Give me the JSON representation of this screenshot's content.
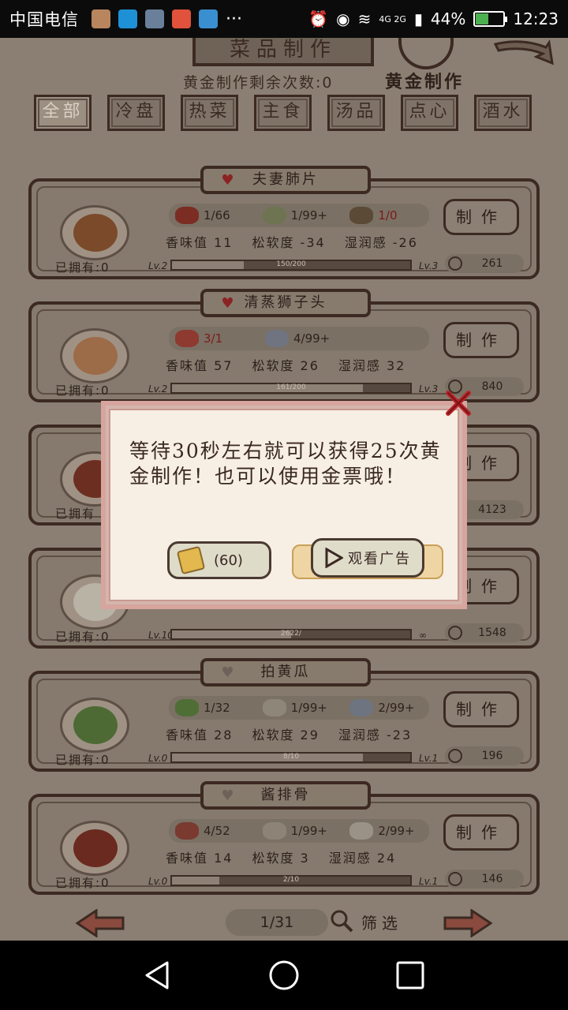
{
  "status_bar": {
    "carrier": "中国电信",
    "network": "4G 2G",
    "battery": "44%",
    "time": "12:23"
  },
  "header": {
    "title": "菜品制作",
    "gold_label": "黄金制作",
    "remaining": "黄金制作剩余次数:0"
  },
  "tabs": [
    {
      "label": "全部"
    },
    {
      "label": "冷盘"
    },
    {
      "label": "热菜"
    },
    {
      "label": "主食"
    },
    {
      "label": "汤品"
    },
    {
      "label": "点心"
    },
    {
      "label": "酒水"
    }
  ],
  "dishes": [
    {
      "name": "夫妻肺片",
      "ingredients": [
        {
          "count": "1/66"
        },
        {
          "count": "1/99+"
        },
        {
          "count": "1/0"
        }
      ],
      "aroma": "香味值 11",
      "softness": "松软度 -34",
      "moisture": "湿润感 -26",
      "owned": "已拥有:0",
      "level_left": "Lv.2",
      "progress": "150/200",
      "level_right": "Lv.3",
      "make_label": "制作",
      "cost": "261"
    },
    {
      "name": "清蒸狮子头",
      "ingredients": [
        {
          "count": "3/1"
        },
        {
          "count": "4/99+"
        }
      ],
      "aroma": "香味值 57",
      "softness": "松软度 26",
      "moisture": "湿润感 32",
      "owned": "已拥有:0",
      "level_left": "Lv.2",
      "progress": "161/200",
      "level_right": "Lv.3",
      "make_label": "制作",
      "cost": "840"
    },
    {
      "name": "",
      "ingredients": [],
      "aroma": "",
      "softness": "",
      "moisture": "",
      "owned": "已拥有",
      "level_left": "",
      "progress": "",
      "level_right": "",
      "make_label": "制作",
      "cost": "4123"
    },
    {
      "name": "",
      "ingredients": [],
      "aroma": "",
      "softness": "",
      "moisture": "",
      "owned": "已拥有:0",
      "level_left": "Lv.10",
      "progress": "2622/",
      "level_right": "∞",
      "make_label": "制作",
      "cost": "1548"
    },
    {
      "name": "拍黄瓜",
      "ingredients": [
        {
          "count": "1/32"
        },
        {
          "count": "1/99+"
        },
        {
          "count": "2/99+"
        }
      ],
      "aroma": "香味值 28",
      "softness": "松软度 29",
      "moisture": "湿润感 -23",
      "owned": "已拥有:0",
      "level_left": "Lv.0",
      "progress": "8/10",
      "level_right": "Lv.1",
      "make_label": "制作",
      "cost": "196"
    },
    {
      "name": "酱排骨",
      "ingredients": [
        {
          "count": "4/52"
        },
        {
          "count": "1/99+"
        },
        {
          "count": "2/99+"
        }
      ],
      "aroma": "香味值 14",
      "softness": "松软度 3",
      "moisture": "湿润感 24",
      "owned": "已拥有:0",
      "level_left": "Lv.0",
      "progress": "2/10",
      "level_right": "Lv.1",
      "make_label": "制作",
      "cost": "146"
    }
  ],
  "footer": {
    "page": "1/31",
    "filter_label": "筛选"
  },
  "modal": {
    "message": "等待30秒左右就可以获得25次黄金制作！也可以使用金票哦！",
    "ticket_label": "(60)",
    "watch_ad_label": "观看广告"
  }
}
